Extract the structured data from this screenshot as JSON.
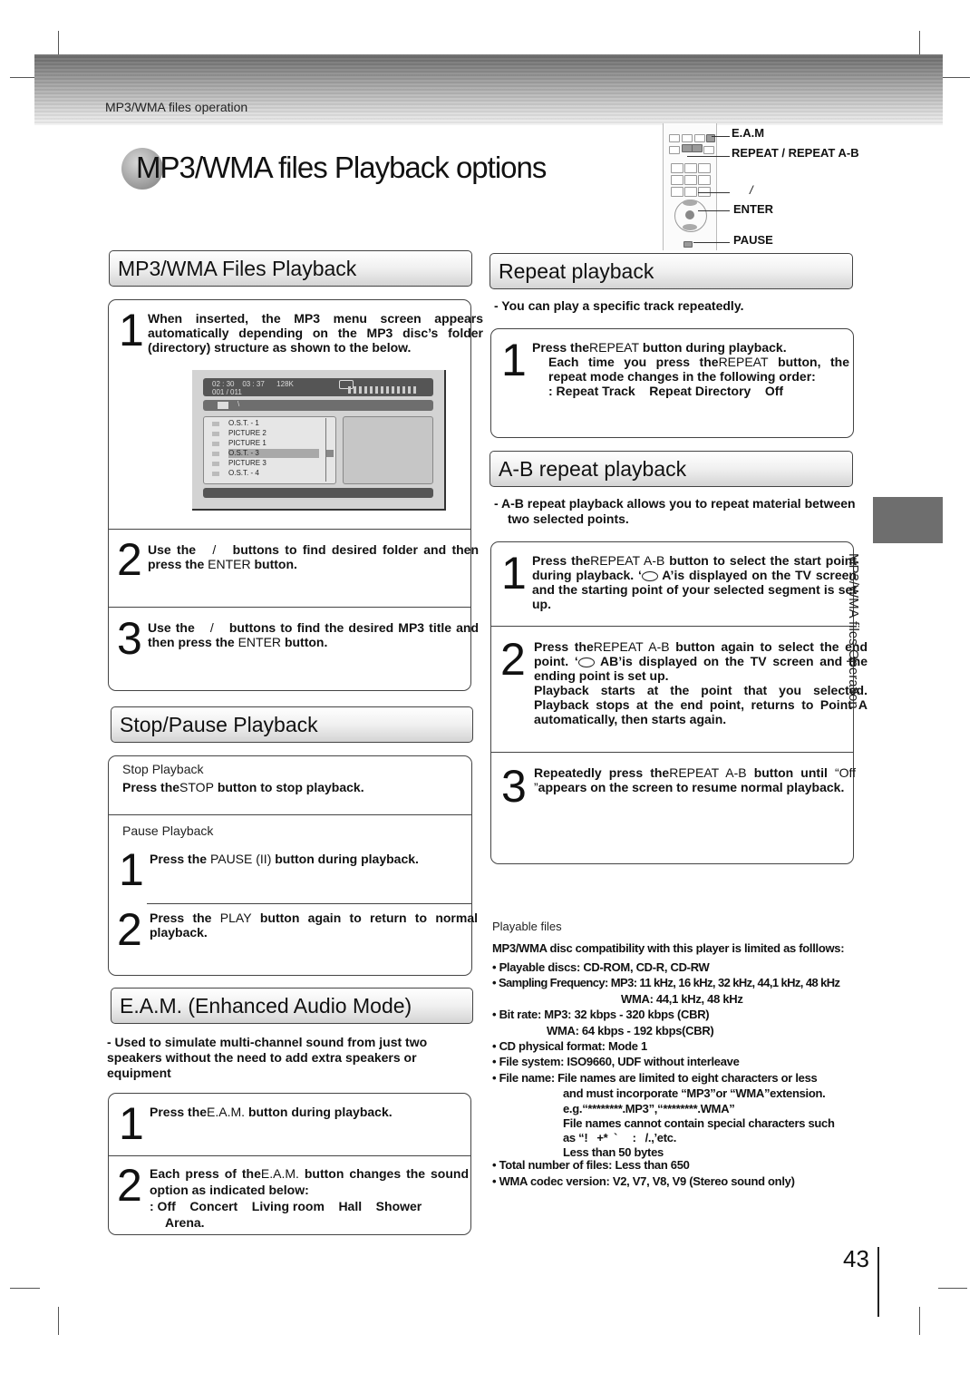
{
  "header": {
    "section_label": "MP3/WMA files operation",
    "page_title": "MP3/WMA files Playback options"
  },
  "remote_callouts": {
    "eam": "E.A.M",
    "repeat": "REPEAT / REPEAT A-B",
    "nav": "/",
    "enter": "ENTER",
    "pause": "PAUSE"
  },
  "files_playback": {
    "title": "MP3/WMA Files Playback",
    "steps": [
      {
        "num": "1",
        "text": "When inserted, the MP3 menu screen appears automatically depending on the MP3 disc’s folder (directory) structure as shown to the below."
      },
      {
        "num": "2",
        "pre": "Use the",
        "sep": "/",
        "mid": "buttons to find desired folder and then press the",
        "key": "ENTER",
        "post": "button."
      },
      {
        "num": "3",
        "pre": "Use the",
        "sep": "/",
        "mid": "buttons to find the desired MP3 title and then press the",
        "key": "ENTER",
        "post": "button."
      }
    ],
    "screen": {
      "elapsed": "02 : 30",
      "total": "03 : 37",
      "bitrate": "128K",
      "track_counter": "001 / 011",
      "path": "\\",
      "items": [
        {
          "icon": "music-icon",
          "label": "O.S.T. - 1",
          "selected": false
        },
        {
          "icon": "picture-icon",
          "label": "PICTURE 2",
          "selected": false
        },
        {
          "icon": "picture-icon",
          "label": "PICTURE 1",
          "selected": false
        },
        {
          "icon": "music-icon",
          "label": "O.S.T. - 3",
          "selected": true
        },
        {
          "icon": "picture-icon",
          "label": "PICTURE 3",
          "selected": false
        },
        {
          "icon": "music-icon",
          "label": "O.S.T. - 4",
          "selected": false
        }
      ]
    }
  },
  "stop_pause": {
    "title": "Stop/Pause Playback",
    "stop_label": "Stop Playback",
    "stop_pre": "Press the",
    "stop_key": "STOP",
    "stop_post": "button to stop playback.",
    "pause_label": "Pause Playback",
    "steps": [
      {
        "num": "1",
        "pre": "Press the",
        "key": "PAUSE (II)",
        "post": "button during playback."
      },
      {
        "num": "2",
        "pre": "Press the",
        "key": "PLAY",
        "post": "button again to return to normal playback."
      }
    ]
  },
  "eam": {
    "title": "E.A.M. (Enhanced Audio Mode)",
    "note": "- Used to simulate multi-channel sound from just two speakers without the need to add extra speakers or equipment",
    "steps": [
      {
        "num": "1",
        "pre": "Press the",
        "key": "E.A.M.",
        "post": "button during playback."
      },
      {
        "num": "2",
        "pre": "Each press of the",
        "key": "E.A.M.",
        "post": "button changes the sound option as indicated below:",
        "sequence": ": Off    Concert    Living room    Hall    Shower",
        "sequence_end": "Arena."
      }
    ]
  },
  "repeat": {
    "title": "Repeat playback",
    "note": "-  You can play a specific track repeatedly.",
    "step": {
      "num": "1",
      "pre": "Press the",
      "key": "REPEAT",
      "post": "button during playback.",
      "line2_pre": "Each time you press the",
      "line2_key": "REPEAT",
      "line2_post": "button, the repeat mode changes in the following order:",
      "sequence": ": Repeat Track    Repeat Directory    Off"
    }
  },
  "ab_repeat": {
    "title": "A-B repeat playback",
    "note": "-  A-B repeat playback allows you to repeat material between two selected points.",
    "steps": [
      {
        "num": "1",
        "pre": "Press the",
        "key": "REPEAT A-B",
        "post": "button to select the start point during playback. ‘",
        "post2": " A’is displayed on the TV screen and the starting point of your selected segment is set up."
      },
      {
        "num": "2",
        "pre": "Press the",
        "key": "REPEAT A-B",
        "post": "button again to select the end point. ‘",
        "post2": " AB’is displayed on the TV screen and the ending point is set up.",
        "extra": "Playback starts at the point that you selected. Playback stops at the end point, returns to Point A automatically, then starts again."
      },
      {
        "num": "3",
        "pre": "Repeatedly press the",
        "key": "REPEAT A-B",
        "post": "button until",
        "quote": "“Off ”",
        "post2": "appears on the screen to resume normal playback."
      }
    ]
  },
  "playable_files": {
    "label": "Playable files",
    "intro": "MP3/WMA disc compatibility with this player is limited as folllows:",
    "lines": [
      "• Playable discs: CD-ROM, CD-R, CD-RW",
      "• Sampling Frequency: MP3: 11 kHz, 16 kHz, 32 kHz, 44,1 kHz, 48 kHz",
      "WMA: 44,1 kHz, 48 kHz",
      "• Bit rate: MP3: 32 kbps - 320 kbps (CBR)",
      "WMA: 64 kbps - 192 kbps(CBR)",
      "• CD physical format: Mode 1",
      "• File system: ISO9660, UDF without interleave",
      "• File name: File names are limited to eight characters or less",
      "and must incorporate “MP3”or “WMA”extension.",
      "e.g.“********.MP3”,“********.WMA”",
      "File names cannot contain special characters such",
      "as “!   +*  `     :   /.,’etc.",
      "Less than 50 bytes",
      "• Total number of files: Less than 650",
      "• WMA codec version: V2, V7, V8, V9 (Stereo sound only)"
    ]
  },
  "side_tab": {
    "label": "MP3/WMA files Operation"
  },
  "page_number": "43"
}
